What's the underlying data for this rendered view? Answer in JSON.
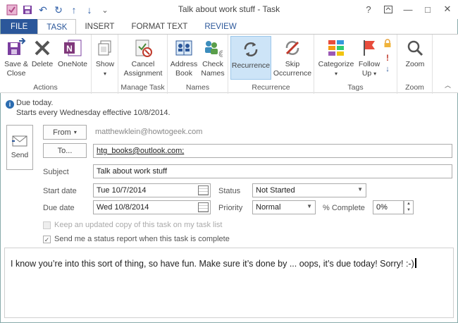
{
  "window": {
    "title": "Talk about work stuff - Task",
    "help": "?",
    "restore": "□",
    "minimize": "—",
    "maximize": "□",
    "close": "✕"
  },
  "qat": {
    "undo": "↶",
    "redo": "↻",
    "up": "↑",
    "down": "↓",
    "more": "⌄"
  },
  "tabs": [
    "FILE",
    "TASK",
    "INSERT",
    "FORMAT TEXT",
    "REVIEW"
  ],
  "ribbon": {
    "actions": {
      "label": "Actions",
      "save_close": [
        "Save &",
        "Close"
      ],
      "delete": "Delete",
      "onenote": "OneNote"
    },
    "show": {
      "label": "Show"
    },
    "manage_task": {
      "label": "Manage Task",
      "cancel_assignment": [
        "Cancel",
        "Assignment"
      ]
    },
    "names": {
      "label": "Names",
      "address_book": [
        "Address",
        "Book"
      ],
      "check_names": [
        "Check",
        "Names"
      ]
    },
    "recurrence": {
      "label": "Recurrence",
      "recurrence_btn": "Recurrence",
      "skip_occurrence": [
        "Skip",
        "Occurrence"
      ]
    },
    "tags": {
      "label": "Tags",
      "categorize": "Categorize",
      "follow_up": [
        "Follow",
        "Up"
      ]
    },
    "zoom": {
      "label": "Zoom",
      "zoom_btn": "Zoom"
    }
  },
  "info": {
    "line1": "Due today.",
    "line2": "Starts every Wednesday effective 10/8/2014."
  },
  "form": {
    "send": "Send",
    "from_btn": "From",
    "from_value": "matthewklein@howtogeek.com",
    "to_btn": "To...",
    "to_value": "htg_books@outlook.com;",
    "subject_label": "Subject",
    "subject_value": "Talk about work stuff",
    "start_label": "Start date",
    "start_value": "Tue 10/7/2014",
    "due_label": "Due date",
    "due_value": "Wed 10/8/2014",
    "status_label": "Status",
    "status_value": "Not Started",
    "priority_label": "Priority",
    "priority_value": "Normal",
    "complete_label": "% Complete",
    "complete_value": "0%",
    "keep_copy": "Keep an updated copy of this task on my task list",
    "status_report": "Send me a status report when this task is complete"
  },
  "body_text": "I know you’re into this sort of thing, so have fun. Make sure it’s done by ... oops, it’s due today! Sorry! :-)",
  "colors": {
    "file_tab": "#2b579a",
    "accent": "#2b579a",
    "selected": "#cde4f7"
  }
}
